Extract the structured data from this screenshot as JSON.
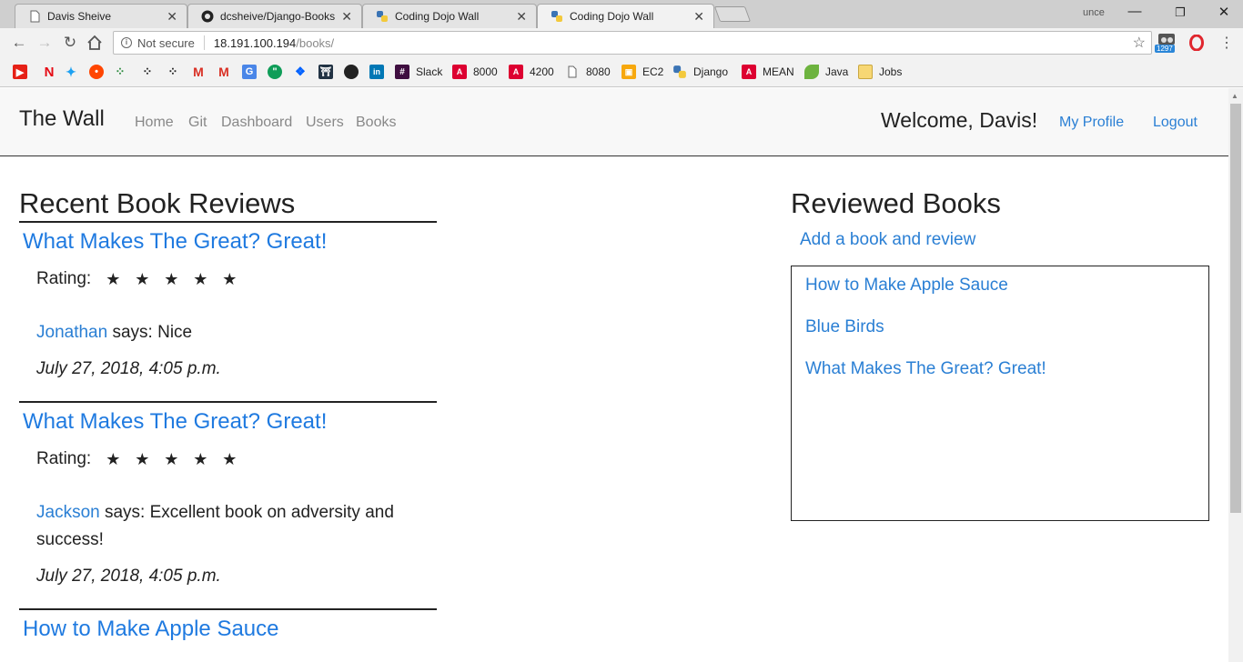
{
  "browser": {
    "tabs": [
      {
        "title": "Davis Sheive",
        "icon": "page-icon"
      },
      {
        "title": "dcsheive/Django-Books",
        "icon": "github-icon"
      },
      {
        "title": "Coding Dojo Wall",
        "icon": "python-icon"
      },
      {
        "title": "Coding Dojo Wall",
        "icon": "python-icon",
        "active": true
      }
    ],
    "profile": "unce",
    "address": {
      "security": "Not secure",
      "host": "18.191.100.194",
      "path": "/books/"
    },
    "extension_badge": "1297",
    "bookmarks": [
      {
        "label": "Slack",
        "icon": "slack-icon"
      },
      {
        "label": "8000",
        "icon": "angular-icon"
      },
      {
        "label": "4200",
        "icon": "angular-icon"
      },
      {
        "label": "8080",
        "icon": "page-icon"
      },
      {
        "label": "EC2",
        "icon": "aws-icon"
      },
      {
        "label": "Django",
        "icon": "python-icon"
      },
      {
        "label": "MEAN",
        "icon": "angular-icon"
      },
      {
        "label": "Java",
        "icon": "spring-icon"
      },
      {
        "label": "Jobs",
        "icon": "folder-icon"
      }
    ]
  },
  "navbar": {
    "brand": "The Wall",
    "links": [
      "Home",
      "Git",
      "Dashboard",
      "Users",
      "Books"
    ],
    "welcome": "Welcome, Davis!",
    "profile_link": "My Profile",
    "logout_link": "Logout"
  },
  "recent": {
    "title": "Recent Book Reviews",
    "rating_label": "Rating:",
    "says": "says:",
    "reviews": [
      {
        "book": "What Makes The Great? Great!",
        "stars": 5,
        "user": "Jonathan",
        "comment": "Nice",
        "date": "July 27, 2018, 4:05 p.m."
      },
      {
        "book": "What Makes The Great? Great!",
        "stars": 5,
        "user": "Jackson",
        "comment": "Excellent book on adversity and success!",
        "date": "July 27, 2018, 4:05 p.m."
      },
      {
        "book": "How to Make Apple Sauce"
      }
    ]
  },
  "reviewed": {
    "title": "Reviewed Books",
    "add_link": "Add a book and review",
    "books": [
      "How to Make Apple Sauce",
      "Blue Birds",
      "What Makes The Great? Great!"
    ]
  },
  "colors": {
    "link": "#2a7fd4",
    "title_link": "#1f7ae0",
    "text": "#222222"
  }
}
